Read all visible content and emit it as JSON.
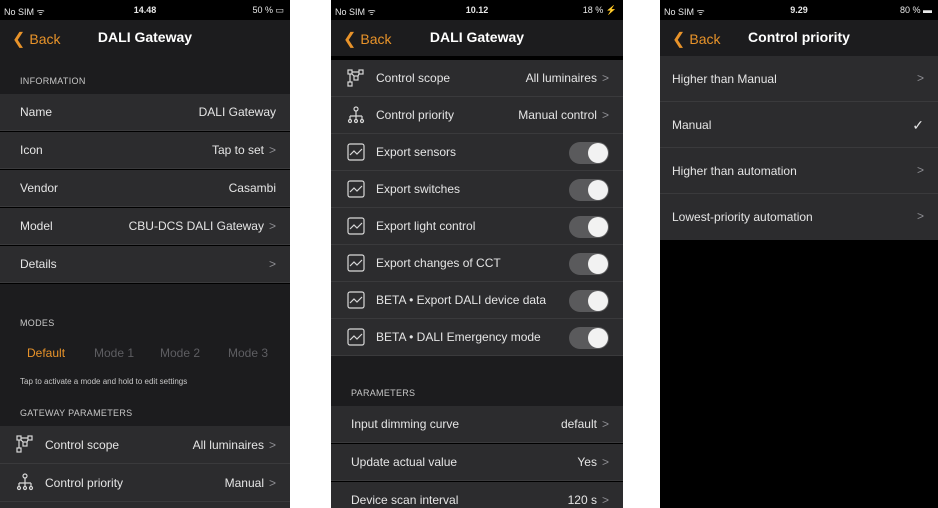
{
  "colors": {
    "accent": "#e8932a",
    "background": "#000000",
    "cell": "#2c2c2e",
    "section": "#1c1c1e"
  },
  "screen1": {
    "status": {
      "carrier": "No SIM ᯤ",
      "time": "14.48",
      "battery": "50 % ▭"
    },
    "nav": {
      "back": "Back",
      "title": "DALI Gateway"
    },
    "info_header": "INFORMATION",
    "info_rows": [
      {
        "label": "Name",
        "value": "DALI Gateway",
        "arrow": ""
      },
      {
        "label": "Icon",
        "value": "Tap to set",
        "arrow": ">"
      },
      {
        "label": "Vendor",
        "value": "Casambi",
        "arrow": ""
      },
      {
        "label": "Model",
        "value": "CBU-DCS DALI Gateway",
        "arrow": ">"
      },
      {
        "label": "Details",
        "value": "",
        "arrow": ">"
      }
    ],
    "modes_header": "MODES",
    "modes": [
      "Default",
      "Mode 1",
      "Mode 2",
      "Mode 3"
    ],
    "modes_hint": "Tap to activate a mode and hold to edit settings",
    "gw_header": "GATEWAY PARAMETERS",
    "gw_rows": [
      {
        "label": "Control scope",
        "value": "All luminaires",
        "arrow": ">",
        "icon": "scope-icon"
      },
      {
        "label": "Control priority",
        "value": "Manual",
        "arrow": ">",
        "icon": "priority-icon"
      }
    ]
  },
  "screen2": {
    "status": {
      "carrier": "No SIM ᯤ",
      "time": "10.12",
      "battery": "18 % ⚡"
    },
    "nav": {
      "back": "Back",
      "title": "DALI Gateway"
    },
    "rows": [
      {
        "label": "Control scope",
        "value": "All luminaires",
        "arrow": ">"
      },
      {
        "label": "Control priority",
        "value": "Manual control",
        "arrow": ">"
      }
    ],
    "toggles": [
      "Export sensors",
      "Export switches",
      "Export light control",
      "Export changes of CCT",
      "BETA • Export DALI device data",
      "BETA • DALI Emergency mode"
    ],
    "params_header": "PARAMETERS",
    "params": [
      {
        "label": "Input dimming curve",
        "value": "default",
        "arrow": ">"
      },
      {
        "label": "Update actual value",
        "value": "Yes",
        "arrow": ">"
      },
      {
        "label": "Device scan interval",
        "value": "120 s",
        "arrow": ">"
      }
    ]
  },
  "screen3": {
    "status": {
      "carrier": "No SIM ᯤ",
      "time": "9.29",
      "battery": "80 % ▬"
    },
    "nav": {
      "back": "Back",
      "title": "Control priority"
    },
    "options": [
      {
        "label": "Higher than Manual",
        "mark": ">"
      },
      {
        "label": "Manual",
        "mark": "✓"
      },
      {
        "label": "Higher than automation",
        "mark": ">"
      },
      {
        "label": "Lowest-priority automation",
        "mark": ">"
      }
    ]
  }
}
